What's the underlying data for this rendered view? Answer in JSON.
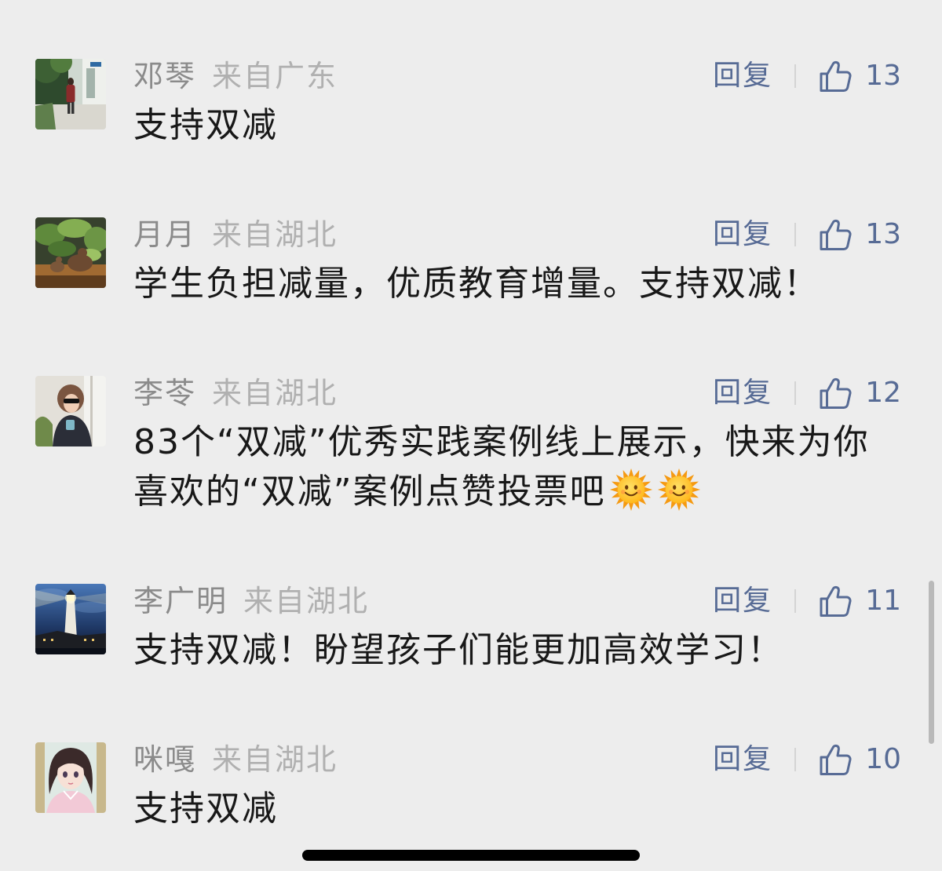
{
  "colors": {
    "background": "#ededed",
    "link": "#576b95",
    "name": "#8b8b8b",
    "location": "#b0b0b0",
    "content": "#181818"
  },
  "comments": [
    {
      "name": "邓琴",
      "location": "来自广东",
      "reply_label": "回复",
      "likes": 13,
      "content_lines": [
        "支持双减"
      ]
    },
    {
      "name": "月月",
      "location": "来自湖北",
      "reply_label": "回复",
      "likes": 13,
      "content_lines": [
        "学生负担减量，优质教育增量。支持双减！"
      ]
    },
    {
      "name": "李苓",
      "location": "来自湖北",
      "reply_label": "回复",
      "likes": 12,
      "content_lines": [
        "83个“双减”优秀实践案例线上展示，快来为你",
        "喜欢的“双减”案例点赞投票吧"
      ],
      "emojis": [
        "sun-with-face",
        "sun-with-face"
      ]
    },
    {
      "name": "李广明",
      "location": "来自湖北",
      "reply_label": "回复",
      "likes": 11,
      "content_lines": [
        "支持双减！盼望孩子们能更加高效学习！"
      ]
    },
    {
      "name": "咪嘎",
      "location": "来自湖北",
      "reply_label": "回复",
      "likes": 10,
      "content_lines": [
        "支持双减"
      ]
    }
  ],
  "icons": {
    "like": "thumbs-up-icon"
  }
}
